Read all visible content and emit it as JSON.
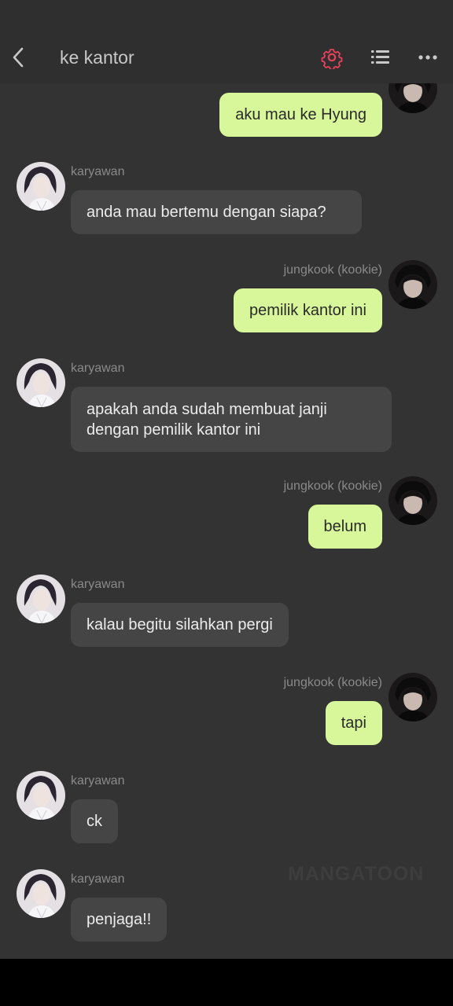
{
  "header": {
    "title": "ke kantor",
    "back_icon": "chevron-left-icon",
    "settings_icon": "gear-icon",
    "settings_color": "#e8415a",
    "list_icon": "list-icon",
    "more_icon": "more-horizontal-icon"
  },
  "messages": [
    {
      "side": "out",
      "name": "",
      "text": "aku mau ke Hyung"
    },
    {
      "side": "in",
      "name": "karyawan",
      "text": "anda mau bertemu dengan siapa?"
    },
    {
      "side": "out",
      "name": "jungkook (kookie)",
      "text": "pemilik kantor ini"
    },
    {
      "side": "in",
      "name": "karyawan",
      "text": "apakah anda sudah membuat janji\ndengan pemilik kantor ini"
    },
    {
      "side": "out",
      "name": "jungkook (kookie)",
      "text": "belum"
    },
    {
      "side": "in",
      "name": "karyawan",
      "text": "kalau begitu silahkan pergi"
    },
    {
      "side": "out",
      "name": "jungkook (kookie)",
      "text": "tapi"
    },
    {
      "side": "in",
      "name": "karyawan",
      "text": "ck"
    },
    {
      "side": "in",
      "name": "karyawan",
      "text": "penjaga!!"
    }
  ],
  "watermark": "MANGATOON",
  "colors": {
    "outgoing_bubble": "#d8f69a",
    "incoming_bubble": "#454545",
    "background": "#333333"
  }
}
